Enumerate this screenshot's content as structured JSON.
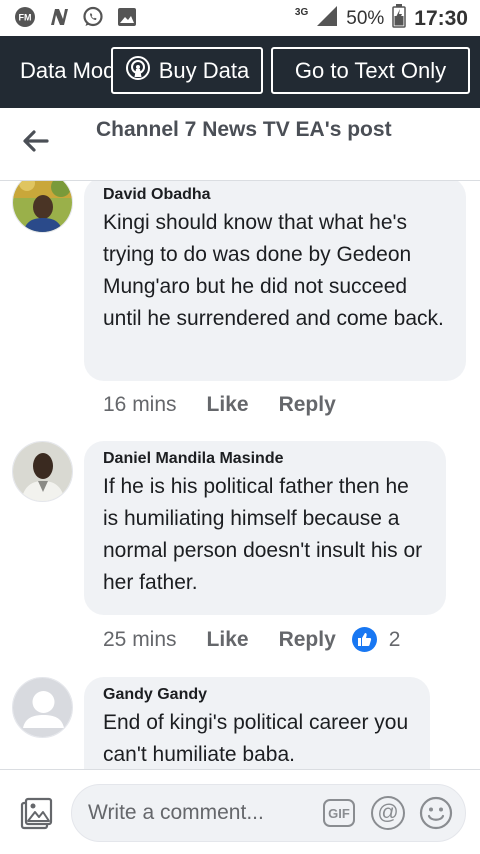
{
  "status_bar": {
    "icons": [
      "fm-radio-icon",
      "n-notification-icon",
      "whatsapp-icon",
      "gallery-icon"
    ],
    "network": "3G",
    "battery": "50%",
    "time": "17:30"
  },
  "banner": {
    "text": "Data Mode",
    "buy_data": "Buy Data",
    "text_only": "Go to Text Only"
  },
  "header": {
    "title": "Channel 7 News TV EA's post"
  },
  "comments": [
    {
      "author": "David Obadha",
      "text": "Kingi should know that what he's trying to do was done by Gedeon Mung'aro but he did not succeed until he surrendered and come back.",
      "time": "16 mins",
      "like": "Like",
      "reply": "Reply"
    },
    {
      "author": "Daniel Mandila Masinde",
      "text": "If he is his political father then he is humiliating himself because a normal person doesn't insult his or her father.",
      "time": "25 mins",
      "like": "Like",
      "reply": "Reply",
      "reactions": "2"
    },
    {
      "author": "Gandy Gandy",
      "text": "End of kingi's political career you can't humiliate baba."
    }
  ],
  "composer": {
    "placeholder": "Write a comment...",
    "gif": "GIF",
    "at": "@"
  },
  "colors": {
    "banner_bg": "#222a33",
    "bubble_bg": "#f0f2f5",
    "like_blue": "#1877f2",
    "meta_grey": "#65676b"
  }
}
